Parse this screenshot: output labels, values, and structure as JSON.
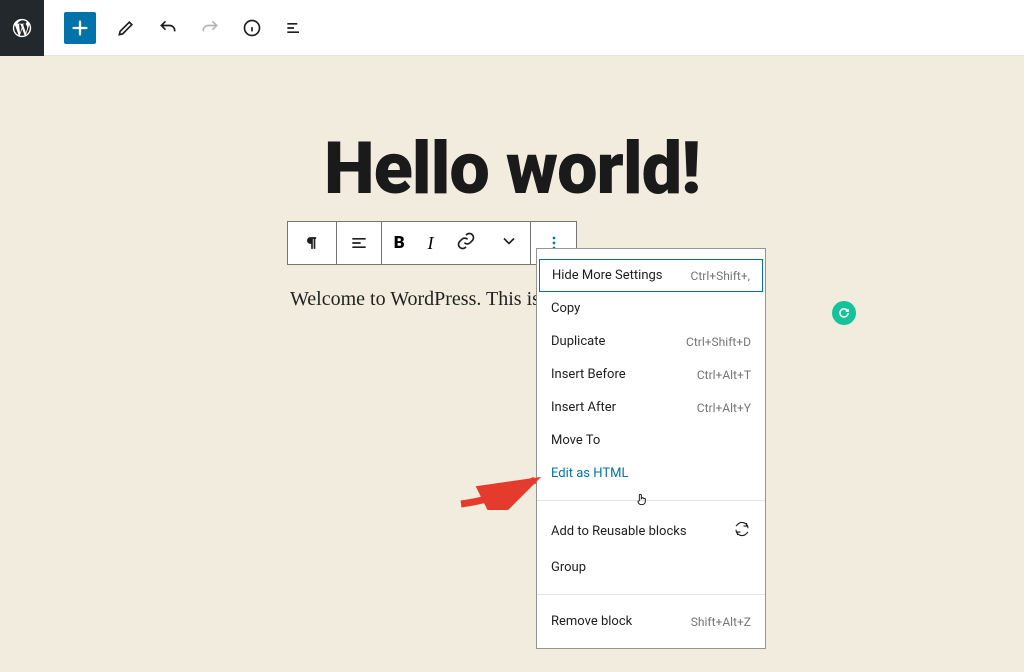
{
  "page": {
    "title": "Hello world!",
    "paragraph": "Welcome to WordPress. This is                                    t, then start writing!"
  },
  "dropdown": {
    "hide_more": "Hide More Settings",
    "hide_more_kbd": "Ctrl+Shift+,",
    "copy": "Copy",
    "duplicate": "Duplicate",
    "duplicate_kbd": "Ctrl+Shift+D",
    "insert_before": "Insert Before",
    "insert_before_kbd": "Ctrl+Alt+T",
    "insert_after": "Insert After",
    "insert_after_kbd": "Ctrl+Alt+Y",
    "move_to": "Move To",
    "edit_html": "Edit as HTML",
    "add_reusable": "Add to Reusable blocks",
    "group": "Group",
    "remove": "Remove block",
    "remove_kbd": "Shift+Alt+Z"
  }
}
